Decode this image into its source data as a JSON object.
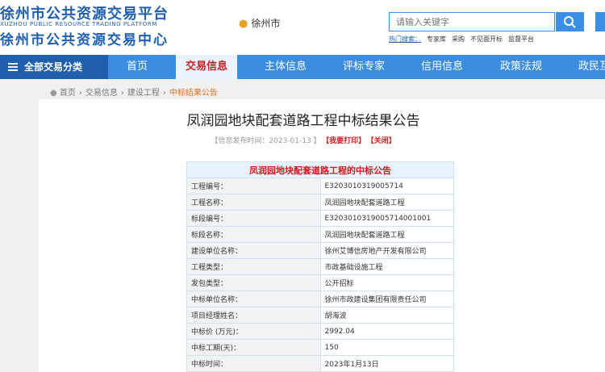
{
  "header": {
    "logo_line1": "徐州市公共资源交易平台",
    "logo_en": "XUZHOU PUBLIC RESOURCE TRADING PLATFORM",
    "logo_line2": "徐州市公共资源交易中心",
    "location": "徐州市",
    "search_placeholder": "请输入关键字",
    "hot_label": "热门搜索：",
    "hot_items": [
      "专家库",
      "采购",
      "不见面开标",
      "监督平台"
    ]
  },
  "nav": {
    "all_label": "全部交易分类",
    "items": [
      "首页",
      "交易信息",
      "主体信息",
      "评标专家",
      "信用信息",
      "政策法规",
      "政民互"
    ],
    "active_index": 1
  },
  "breadcrumb": [
    "首页",
    "交易信息",
    "建设工程",
    "中标结果公告"
  ],
  "article": {
    "title": "凤润园地块配套道路工程中标结果公告",
    "publish_prefix": "【信息发布时间：2023-01-13 】",
    "print_label": "【我要打印】",
    "close_label": "【关闭】",
    "table_title": "凤润园地块配套道路工程的中标公告",
    "rows": [
      {
        "k": "工程编号：",
        "v": "E3203010319005714"
      },
      {
        "k": "工程名称：",
        "v": "凤润园地块配套道路工程"
      },
      {
        "k": "标段编号：",
        "v": "E3203010319005714001001"
      },
      {
        "k": "标段名称：",
        "v": "凤润园地块配套道路工程"
      },
      {
        "k": "建设单位名称：",
        "v": "徐州艾博信房地产开发有限公司"
      },
      {
        "k": "工程类型：",
        "v": "市政基础设施工程"
      },
      {
        "k": "发包类型：",
        "v": "公开招标"
      },
      {
        "k": "中标单位名称：",
        "v": "徐州市政建设集团有限责任公司"
      },
      {
        "k": "项目经理姓名：",
        "v": "胡海波"
      },
      {
        "k": "中标价 (万元)：",
        "v": "2992.04"
      },
      {
        "k": "中标工期(天)：",
        "v": "150"
      },
      {
        "k": "中标时间：",
        "v": "2023年1月13日"
      }
    ]
  },
  "colors": {
    "brand": "#1f5fb0",
    "nav": "#3b8de0",
    "accent_red": "#d4161c"
  },
  "icons": {
    "location": "location-pin-icon",
    "search": "search-icon",
    "menu": "menu-icon",
    "home": "home-pin-icon"
  }
}
